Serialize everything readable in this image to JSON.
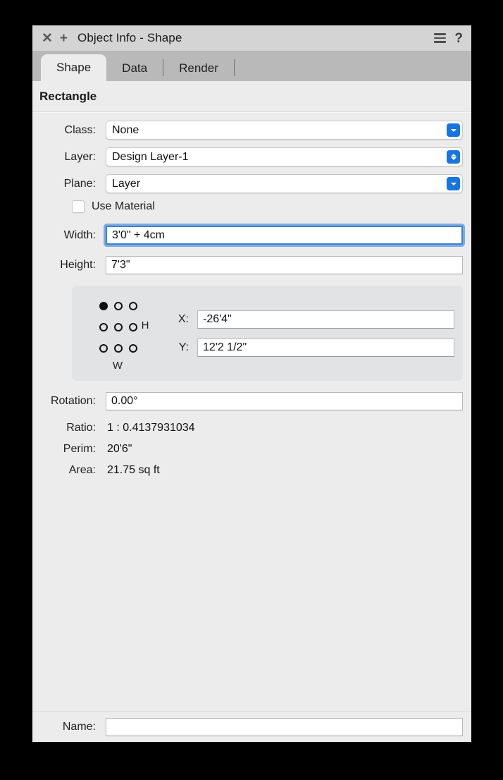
{
  "titlebar": {
    "close_icon": "close-icon",
    "add_icon": "plus-icon",
    "title": "Object Info - Shape",
    "menu_icon": "hamburger-menu-icon",
    "help_label": "?"
  },
  "tabs": [
    {
      "label": "Shape",
      "active": true
    },
    {
      "label": "Data",
      "active": false
    },
    {
      "label": "Render",
      "active": false
    }
  ],
  "shape": {
    "object_type": "Rectangle",
    "class": {
      "label": "Class:",
      "value": "None",
      "button": "chevron-down-icon"
    },
    "layer": {
      "label": "Layer:",
      "value": "Design Layer-1",
      "button": "chevron-up-down-icon"
    },
    "plane": {
      "label": "Plane:",
      "value": "Layer",
      "button": "chevron-down-icon"
    },
    "use_material": {
      "label": "Use Material",
      "checked": false
    },
    "width": {
      "label": "Width:",
      "value": "3'0\" + 4cm",
      "focused": true
    },
    "height": {
      "label": "Height:",
      "value": "7'3\"",
      "focused": false
    },
    "anchor": {
      "selected_index": 0,
      "h_label": "H",
      "w_label": "W"
    },
    "x": {
      "label": "X:",
      "value": "-26'4\""
    },
    "y": {
      "label": "Y:",
      "value": "12'2 1/2\""
    },
    "rotation": {
      "label": "Rotation:",
      "value": "0.00°"
    },
    "ratio": {
      "label": "Ratio:",
      "value": "1 : 0.4137931034"
    },
    "perim": {
      "label": "Perim:",
      "value": "20'6\""
    },
    "area": {
      "label": "Area:",
      "value": "21.75 sq ft"
    },
    "name": {
      "label": "Name:",
      "value": "",
      "placeholder": ""
    }
  },
  "colors": {
    "accent": "#1675e0",
    "focus_ring": "#5a96dc",
    "window_bg": "#ececec",
    "titlebar_bg": "#d4d4d4",
    "tabbar_bg": "#b9b9b9",
    "groupbox_bg": "#e2e3e5"
  }
}
